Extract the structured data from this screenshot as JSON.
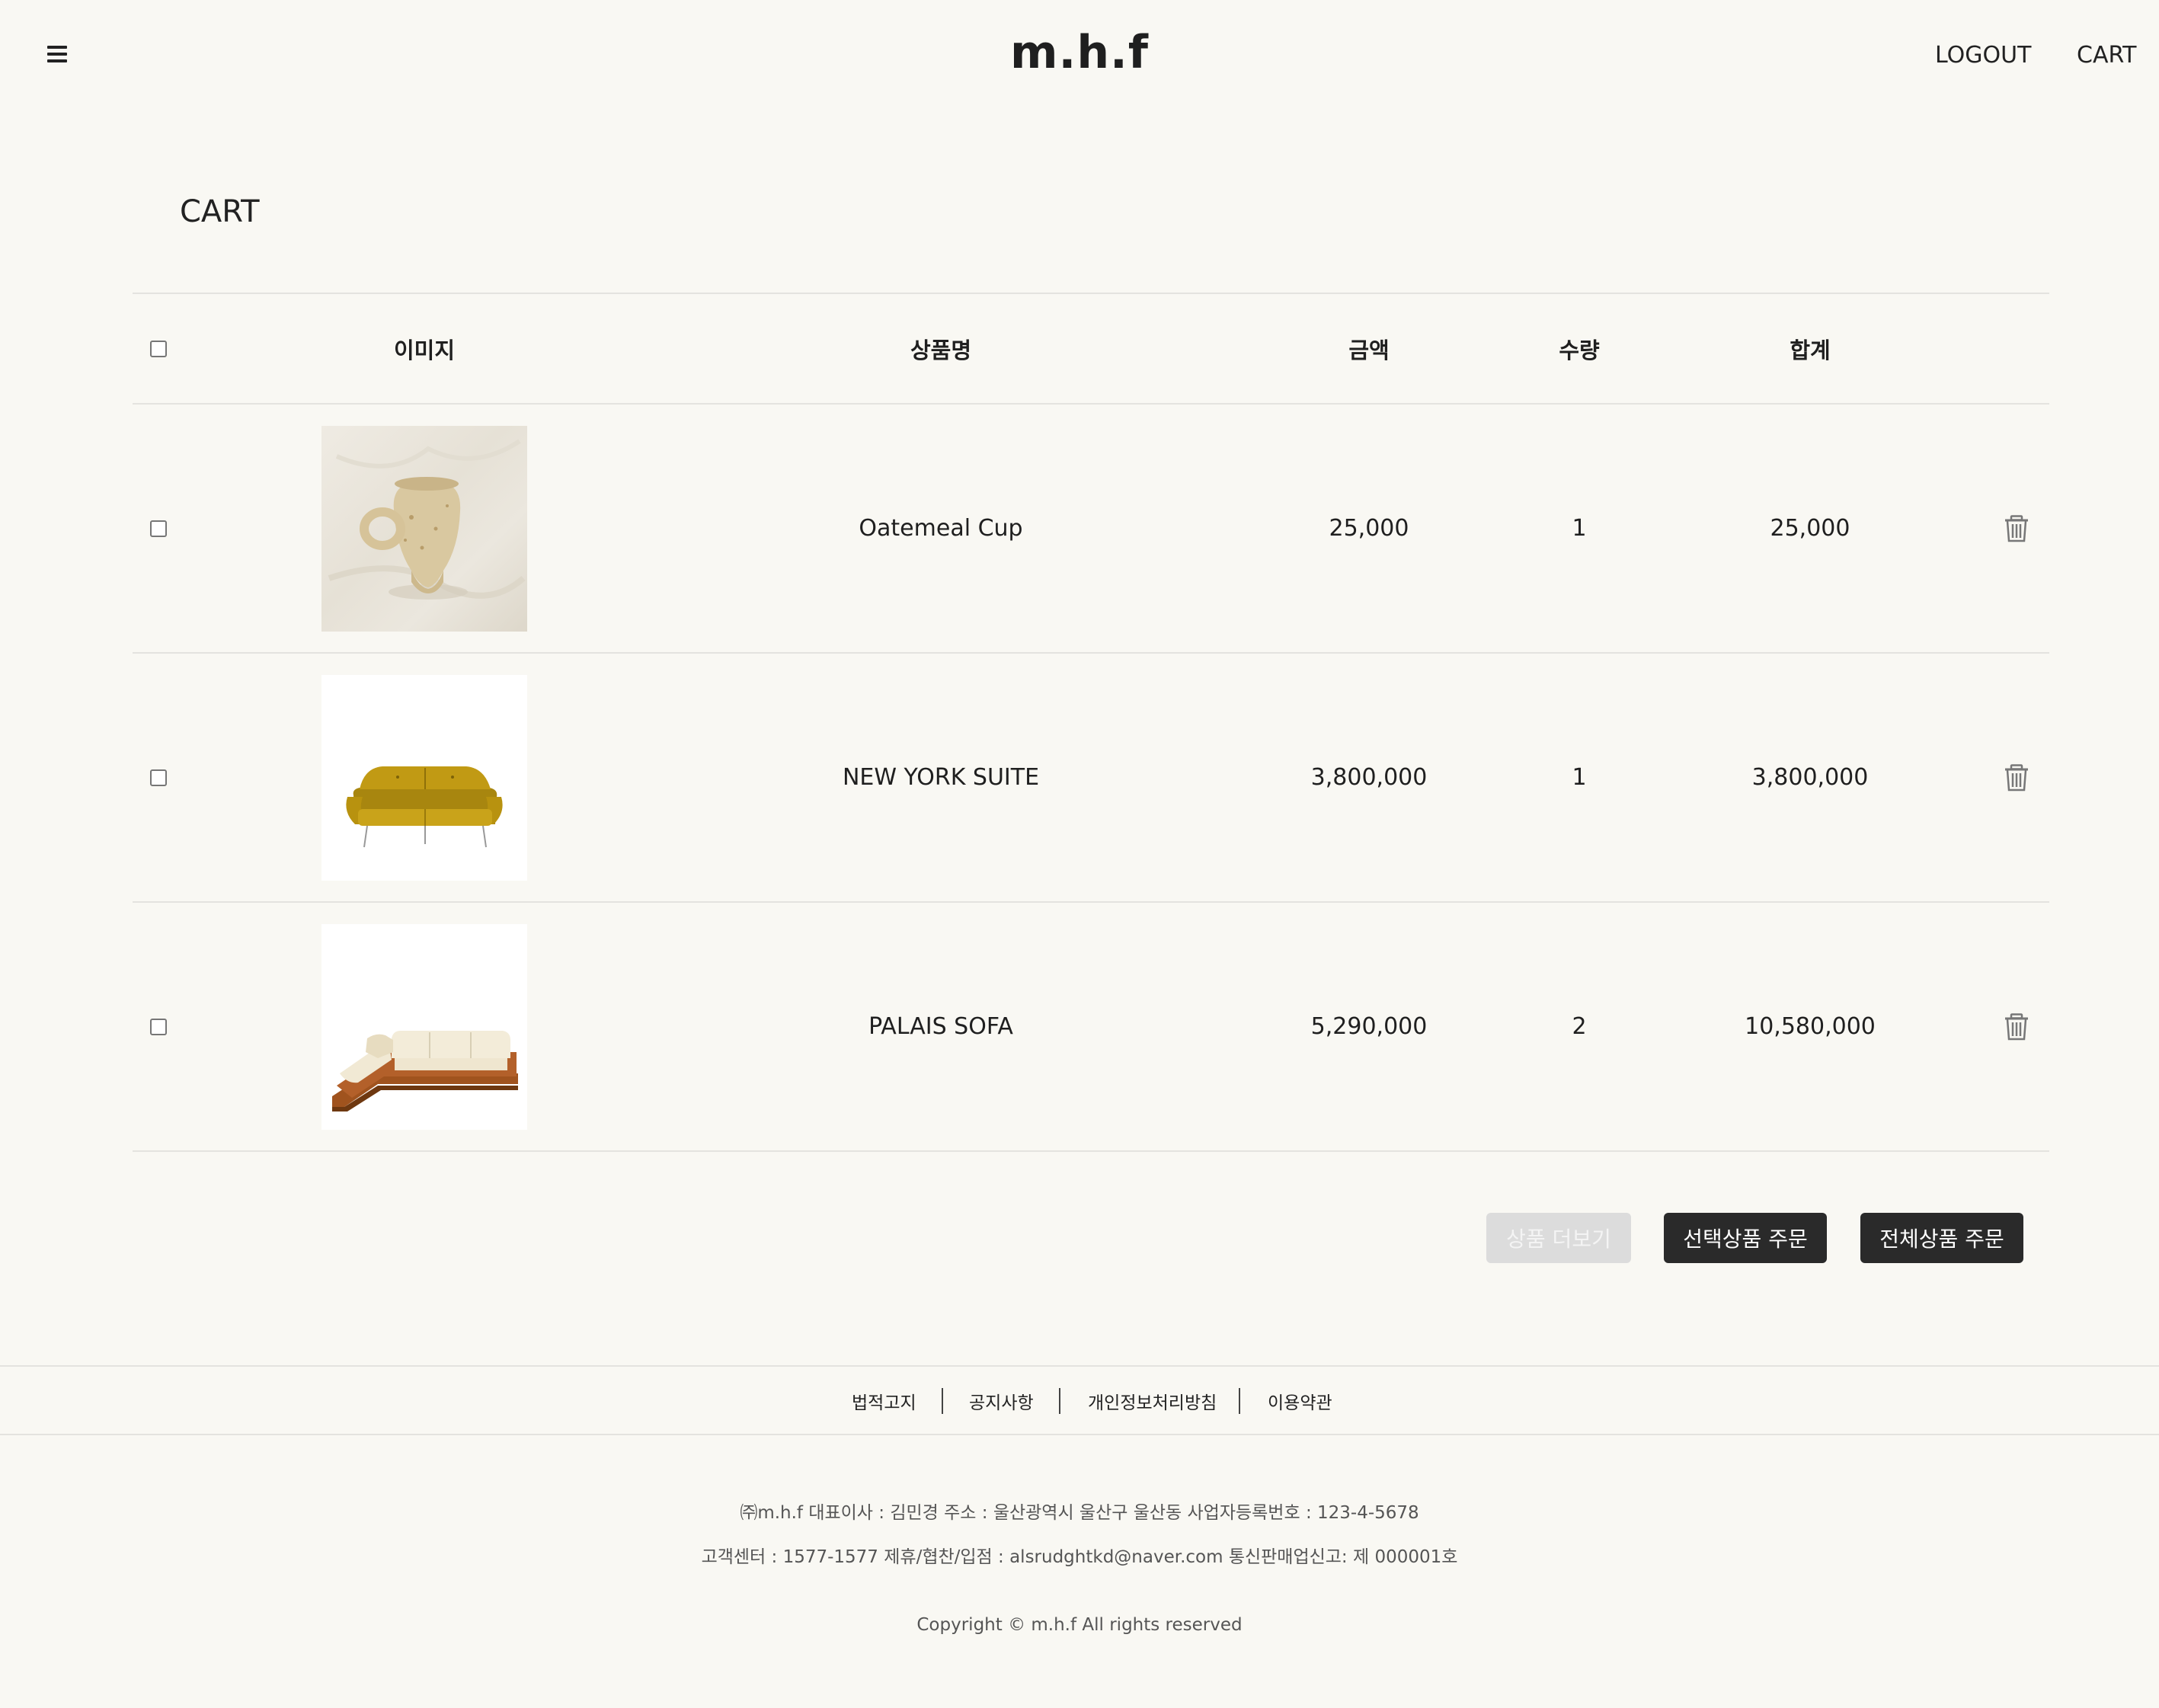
{
  "header": {
    "logo": "m.h.f",
    "logout_label": "LOGOUT",
    "cart_label": "CART"
  },
  "page": {
    "title": "CART"
  },
  "table": {
    "columns": {
      "image": "이미지",
      "name": "상품명",
      "price": "금액",
      "quantity": "수량",
      "total": "합계"
    },
    "rows": [
      {
        "name": "Oatemeal Cup",
        "price": "25,000",
        "quantity": "1",
        "total": "25,000"
      },
      {
        "name": "NEW YORK SUITE",
        "price": "3,800,000",
        "quantity": "1",
        "total": "3,800,000"
      },
      {
        "name": "PALAIS SOFA",
        "price": "5,290,000",
        "quantity": "2",
        "total": "10,580,000"
      }
    ]
  },
  "actions": {
    "more_label": "상품 더보기",
    "order_selected_label": "선택상품 주문",
    "order_all_label": "전체상품 주문"
  },
  "footer": {
    "links": [
      "법적고지",
      "공지사항",
      "개인정보처리방침",
      "이용약관"
    ],
    "company_line": "㈜m.h.f 대표이사 : 김민경 주소 : 울산광역시 울산구 울산동 사업자등록번호 : 123-4-5678",
    "contact_line": "고객센터 : 1577-1577 제휴/협찬/입점 : alsrudghtkd@naver.com 통신판매업신고: 제 000001호",
    "copyright": "Copyright © m.h.f All rights reserved"
  },
  "icons": {
    "menu": "hamburger-menu-icon",
    "delete": "trash-icon"
  },
  "colors": {
    "background": "#f9f8f3",
    "button_dark": "#2a2a2a",
    "button_disabled": "#dcdcdc",
    "text": "#1f1f1f"
  }
}
